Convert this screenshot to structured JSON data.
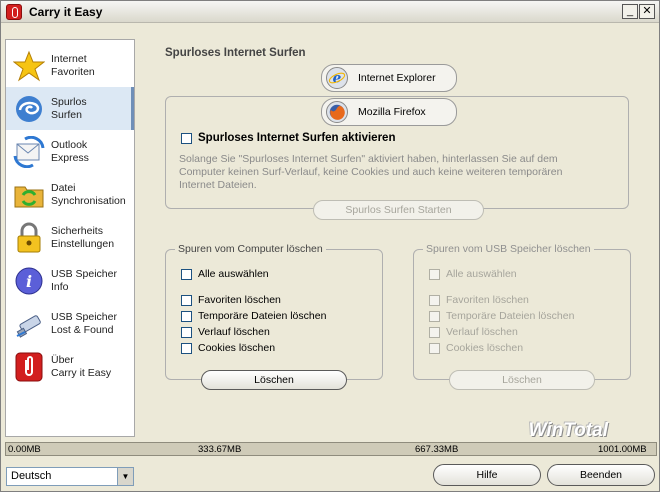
{
  "window": {
    "title": "Carry it Easy",
    "minimize_glyph": "_",
    "close_glyph": "✕"
  },
  "sidebar": {
    "items": [
      {
        "label": "Internet\nFavoriten",
        "icon": "star-icon",
        "active": false
      },
      {
        "label": "Spurlos\nSurfen",
        "icon": "swirl-icon",
        "active": true
      },
      {
        "label": "Outlook\nExpress",
        "icon": "sync-mail-icon",
        "active": false
      },
      {
        "label": "Datei\nSynchronisation",
        "icon": "folder-sync-icon",
        "active": false
      },
      {
        "label": "Sicherheits\nEinstellungen",
        "icon": "lock-icon",
        "active": false
      },
      {
        "label": "USB Speicher\nInfo",
        "icon": "info-icon",
        "active": false
      },
      {
        "label": "USB Speicher\nLost & Found",
        "icon": "usb-stick-icon",
        "active": false
      },
      {
        "label": "Über\nCarry it Easy",
        "icon": "app-logo-icon",
        "active": false
      }
    ]
  },
  "main": {
    "section_title": "Spurloses Internet Surfen",
    "browsers": [
      {
        "label": "Internet Explorer",
        "icon": "internet-explorer-icon"
      },
      {
        "label": "Mozilla Firefox",
        "icon": "firefox-icon"
      }
    ],
    "activate_label": "Spurloses Internet Surfen aktivieren",
    "description": "Solange Sie \"Spurloses Internet Surfen\" aktiviert haben, hinterlassen Sie auf dem Computer keinen Surf-Verlauf, keine Cookies und auch keine weiteren temporären Internet Dateien.",
    "start_button": "Spurlos Surfen Starten",
    "computer_group": {
      "legend": "Spuren vom Computer löschen",
      "select_all": "Alle auswählen",
      "options": [
        "Favoriten löschen",
        "Temporäre Dateien löschen",
        "Verlauf löschen",
        "Cookies löschen"
      ],
      "delete_button": "Löschen"
    },
    "usb_group": {
      "legend": "Spuren vom USB Speicher löschen",
      "select_all": "Alle auswählen",
      "options": [
        "Favoriten löschen",
        "Temporäre Dateien löschen",
        "Verlauf löschen",
        "Cookies löschen"
      ],
      "delete_button": "Löschen"
    }
  },
  "memory_bar": {
    "labels": [
      "0.00MB",
      "333.67MB",
      "667.33MB",
      "1001.00MB"
    ],
    "used_fraction": 0.0,
    "watermark": "WinTotal"
  },
  "footer": {
    "language": "Deutsch",
    "help_button": "Hilfe",
    "exit_button": "Beenden"
  },
  "colors": {
    "background": "#ECE9D8",
    "active_item": "#DCE8F4",
    "accent": "#6F8FB8"
  }
}
